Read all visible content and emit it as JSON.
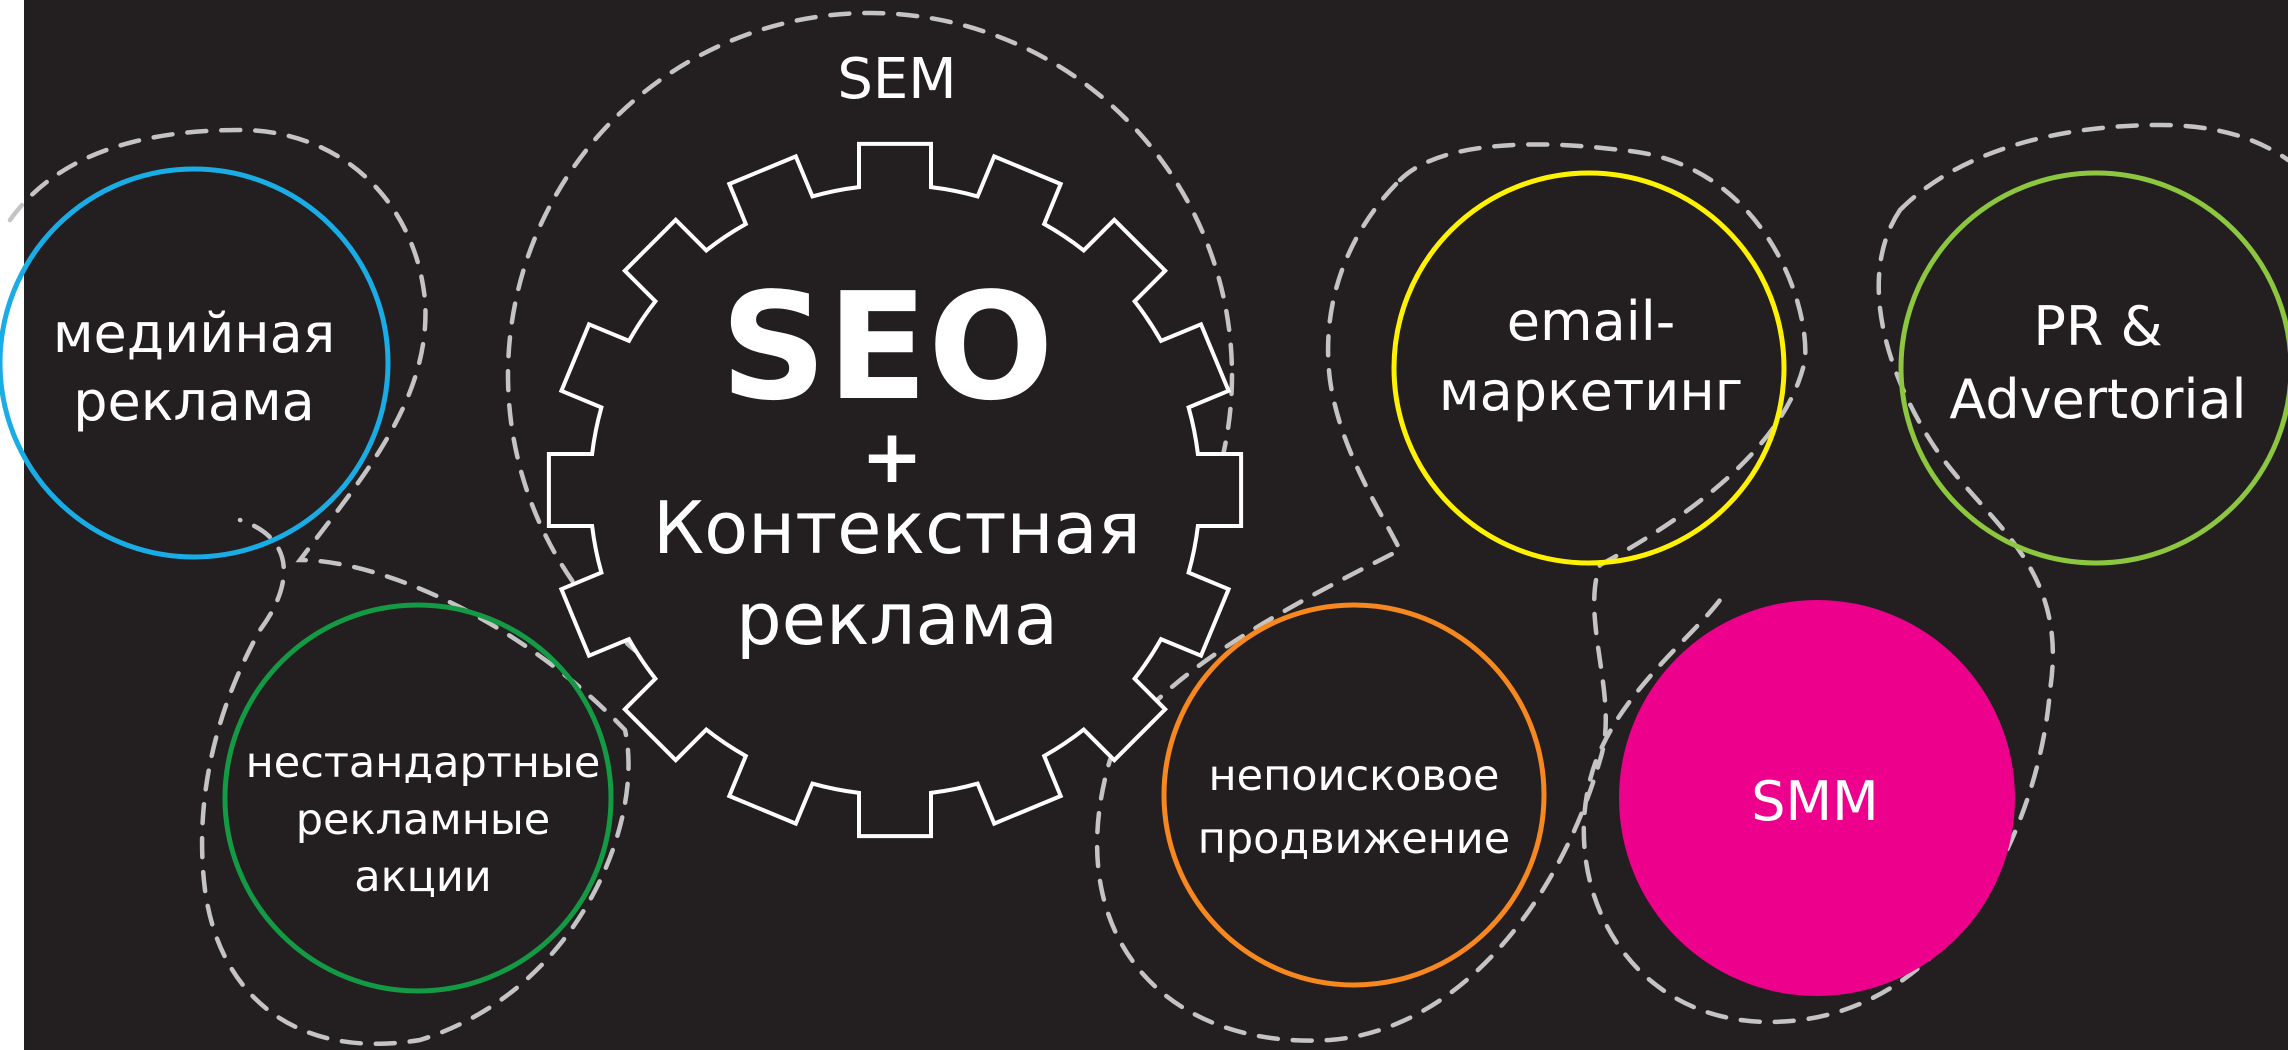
{
  "diagram": {
    "colors": {
      "background": "#231f20",
      "dashed_outline": "#c4c4c4",
      "text": "#ffffff",
      "media": "#1aace5",
      "nonstandard": "#149a44",
      "email": "#fff200",
      "nonsearch": "#f7871f",
      "smm": "#ec008c",
      "pr": "#8dc63f"
    },
    "sem_label": "SEM",
    "center": {
      "seo": "SEO",
      "plus": "+",
      "line1": "Контекстная",
      "line2": "реклама"
    },
    "nodes": {
      "media": {
        "line1": "медийная",
        "line2": "реклама"
      },
      "nonstandard": {
        "line1": "нестандартные",
        "line2": "рекламные",
        "line3": "акции"
      },
      "email": {
        "line1": "email-",
        "line2": "маркетинг"
      },
      "pr": {
        "line1": "PR &",
        "line2": "Advertorial"
      },
      "nonsearch": {
        "line1": "непоисковое",
        "line2": "продвижение"
      },
      "smm": {
        "label": "SMM"
      }
    }
  }
}
